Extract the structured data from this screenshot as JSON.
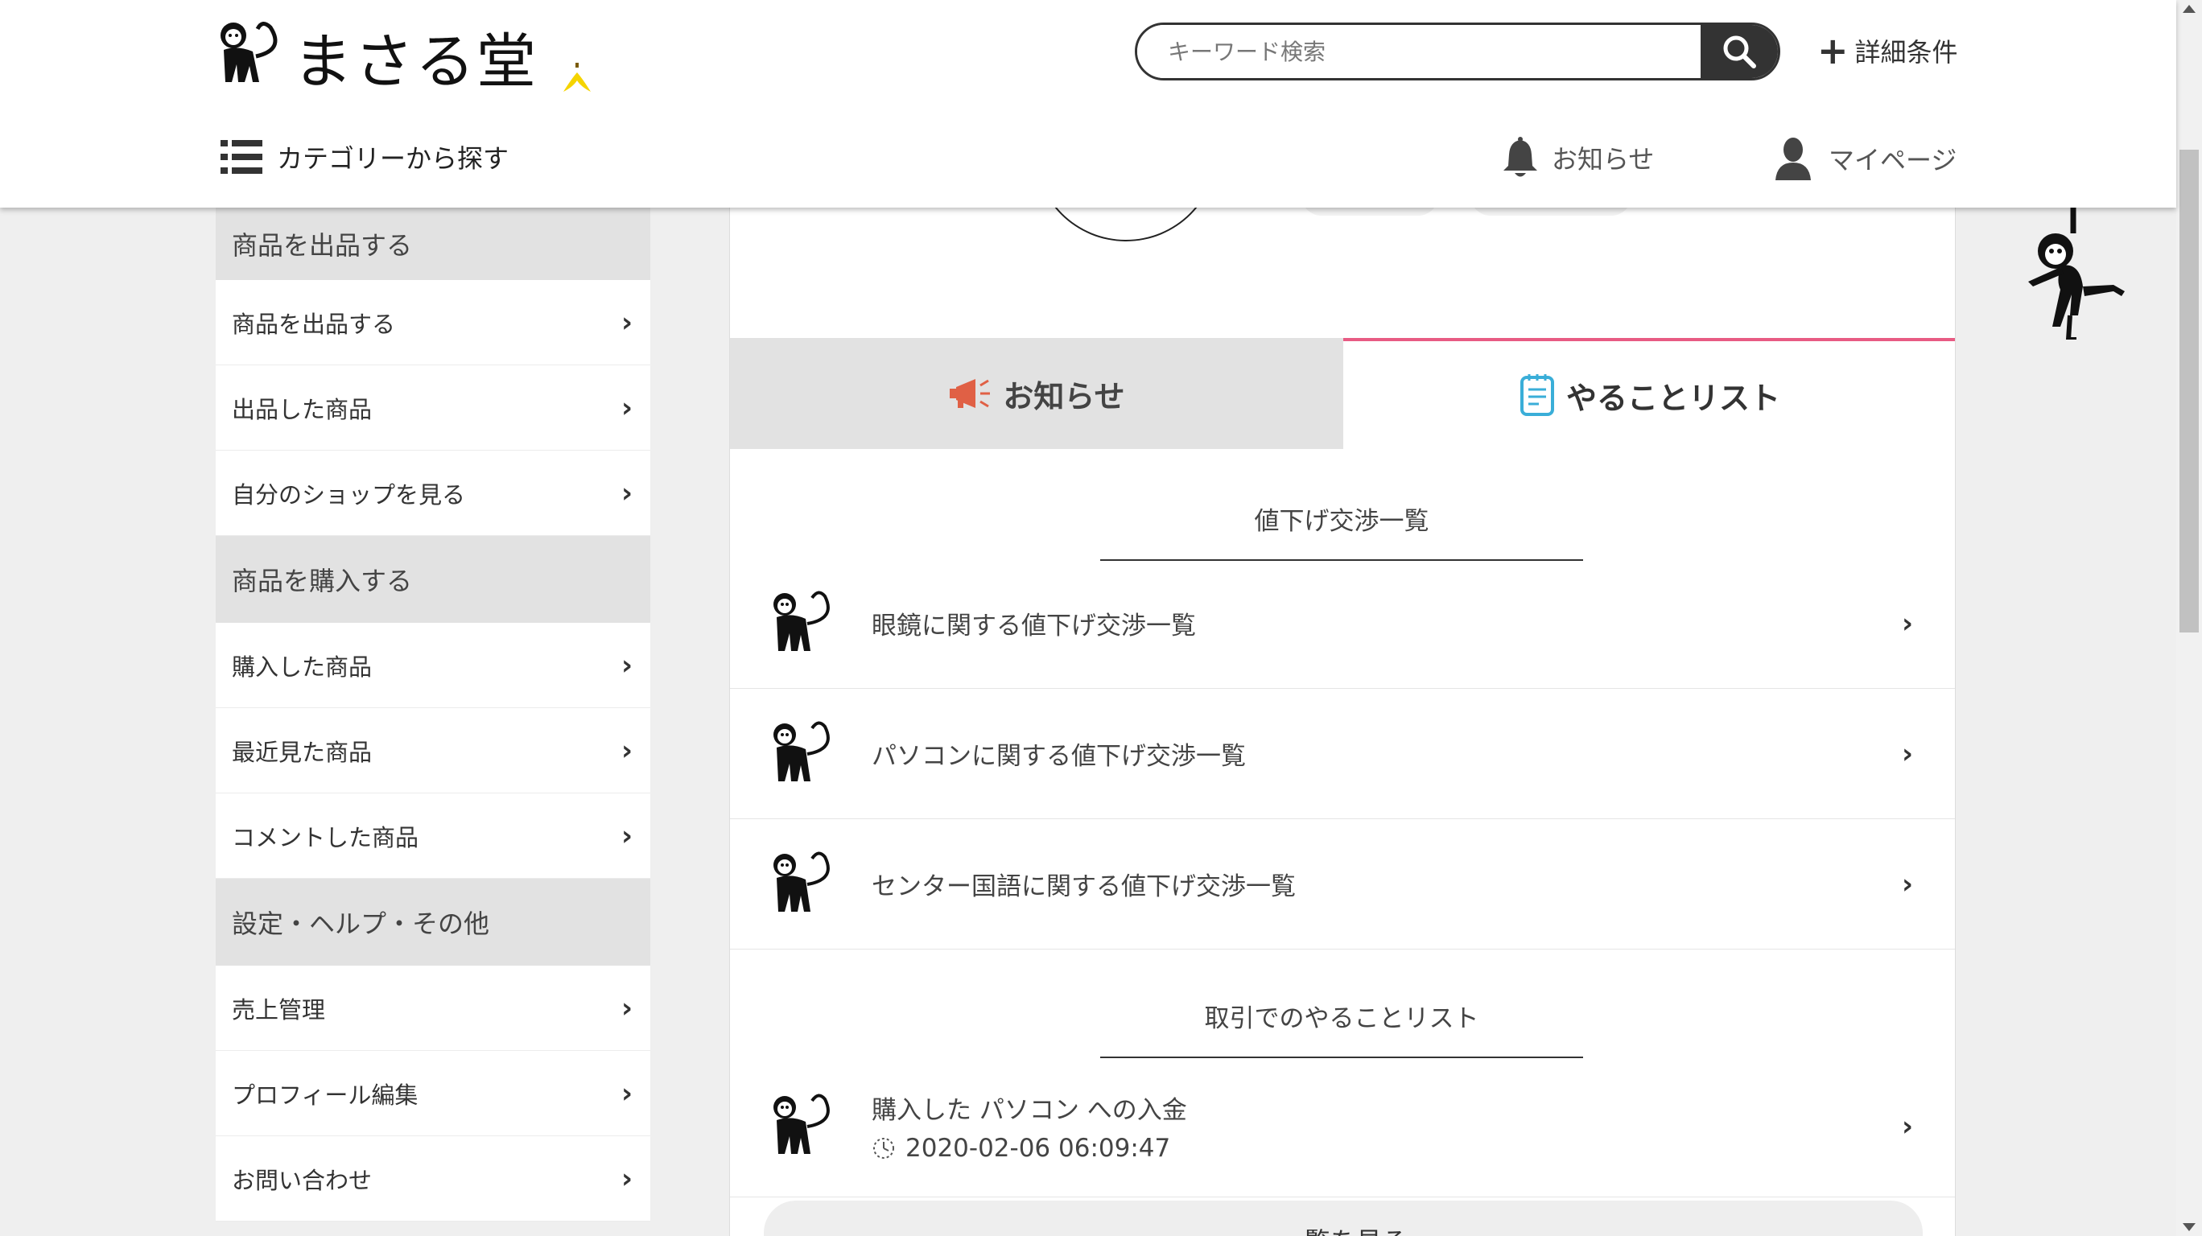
{
  "header": {
    "logo_text": "まさる堂",
    "search_placeholder": "キーワード検索",
    "detail_conditions": "詳細条件",
    "category_link": "カテゴリーから探す",
    "notice_link": "お知らせ",
    "mypage_link": "マイページ"
  },
  "sidebar": {
    "sections": [
      {
        "title": "商品を出品する",
        "items": [
          "商品を出品する",
          "出品した商品",
          "自分のショップを見る"
        ]
      },
      {
        "title": "商品を購入する",
        "items": [
          "購入した商品",
          "最近見た商品",
          "コメントした商品"
        ]
      },
      {
        "title": "設定・ヘルプ・その他",
        "items": [
          "売上管理",
          "プロフィール編集",
          "お問い合わせ"
        ]
      }
    ]
  },
  "tabs": {
    "notice": "お知らせ",
    "todo": "やることリスト",
    "active": "todo"
  },
  "negotiation": {
    "title": "値下げ交渉一覧",
    "rows": [
      "眼鏡に関する値下げ交渉一覧",
      "パソコンに関する値下げ交渉一覧",
      "センター国語に関する値下げ交渉一覧"
    ]
  },
  "transaction_todo": {
    "title": "取引でのやることリスト",
    "rows": [
      {
        "label": "購入した パソコン への入金",
        "timestamp": "2020-02-06 06:09:47"
      }
    ]
  },
  "more_button": "一覧を見る",
  "colors": {
    "accent_tab": "#e85b83",
    "megaphone": "#e06045",
    "todo_icon": "#3aaed8",
    "banana": "#f5d400"
  }
}
